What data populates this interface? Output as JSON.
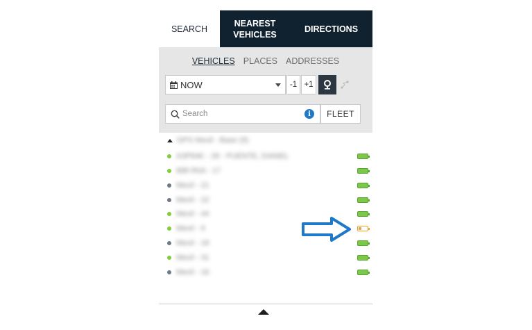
{
  "tabs": {
    "search": "SEARCH",
    "nearest": "NEAREST\nVEHICLES",
    "directions": "DIRECTIONS"
  },
  "subtabs": {
    "vehicles": "VEHICLES",
    "places": "PLACES",
    "addresses": "ADDRESSES"
  },
  "time": {
    "selected": "NOW",
    "minus": "-1",
    "plus": "+1"
  },
  "search": {
    "placeholder": "Search",
    "fleet": "FLEET"
  },
  "list": {
    "group": "GPS Mexil - Base (9)",
    "vehicles": [
      {
        "name": "A3P84K - 28 - PUENTE, DANIEL",
        "status": "online",
        "battery": "full"
      },
      {
        "name": "888 R0A - 17",
        "status": "online",
        "battery": "full"
      },
      {
        "name": "Mexil - 21",
        "status": "offline",
        "battery": "full"
      },
      {
        "name": "Mexil - 22",
        "status": "offline",
        "battery": "full"
      },
      {
        "name": "Mexil - 44",
        "status": "online",
        "battery": "full"
      },
      {
        "name": "Mexil - 9",
        "status": "online",
        "battery": "low"
      },
      {
        "name": "Mexil - 18",
        "status": "offline",
        "battery": "full"
      },
      {
        "name": "Mexil - 31",
        "status": "online",
        "battery": "full"
      },
      {
        "name": "Mexil - 16",
        "status": "offline",
        "battery": "full"
      }
    ]
  },
  "colors": {
    "tab_dark": "#102230",
    "online": "#7fcf3a",
    "offline": "#6e7a86",
    "battery_full": "#7cc84a",
    "battery_low": "#f0a22e",
    "arrow": "#1f78c8"
  }
}
